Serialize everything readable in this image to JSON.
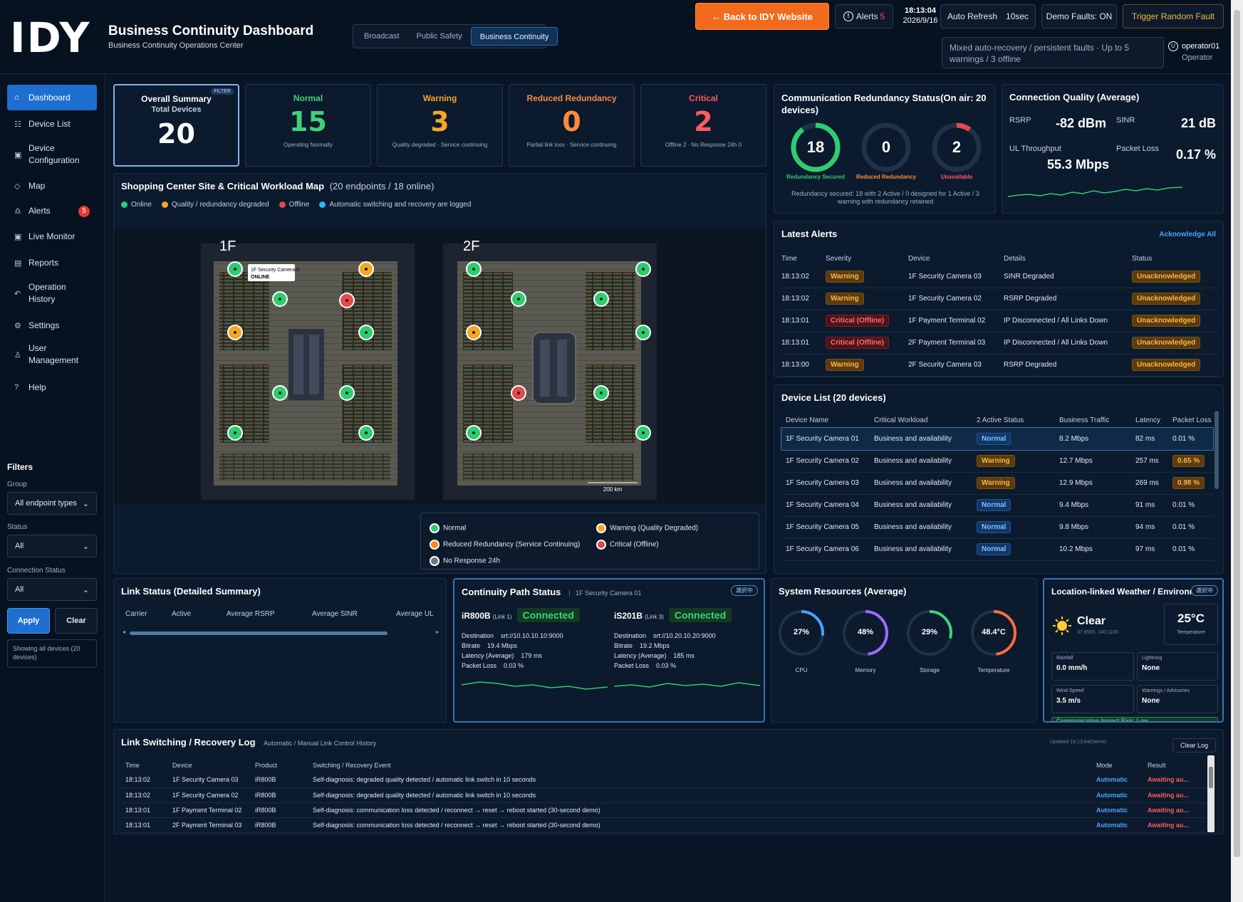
{
  "header": {
    "logo": "IDY",
    "title": "Business Continuity Dashboard",
    "subtitle": "Business Continuity Operations Center",
    "tabs": [
      "Broadcast",
      "Public Safety",
      "Business Continuity"
    ],
    "back_label": "← Back to IDY Website",
    "alerts_label": "Alerts",
    "alerts_count": "5",
    "time": "18:13:04",
    "date": "2026/9/16",
    "auto_refresh_label": "Auto Refresh",
    "auto_refresh_value": "10sec",
    "demo_faults": "Demo Faults: ON",
    "trigger": "Trigger Random Fault",
    "scenario": "Mixed auto-recovery / persistent faults · Up to 5 warnings / 3 offline",
    "operator_name": "operator01",
    "operator_role": "Operator"
  },
  "sidebar": {
    "items": [
      {
        "icon": "⌂",
        "label": "Dashboard"
      },
      {
        "icon": "☷",
        "label": "Device List"
      },
      {
        "icon": "▣",
        "label": "Device Configuration"
      },
      {
        "icon": "◇",
        "label": "Map"
      },
      {
        "icon": "♎",
        "label": "Alerts"
      },
      {
        "icon": "▣",
        "label": "Live Monitor"
      },
      {
        "icon": "▤",
        "label": "Reports"
      },
      {
        "icon": "↶",
        "label": "Operation History"
      },
      {
        "icon": "⚙",
        "label": "Settings"
      },
      {
        "icon": "♙",
        "label": "User Management"
      },
      {
        "icon": "?",
        "label": "Help"
      }
    ],
    "alerts_badge": "5",
    "filters_title": "Filters",
    "group_label": "Group",
    "group_value": "All endpoint types",
    "status_label": "Status",
    "status_value": "All",
    "conn_label": "Connection Status",
    "conn_value": "All",
    "apply": "Apply",
    "clear": "Clear",
    "showing": "Showing all devices (20 devices)"
  },
  "summary": {
    "filter_tag": "FILTER",
    "overall_title": "Overall Summary",
    "overall_sub": "Total Devices",
    "overall_value": "20",
    "normal_title": "Normal",
    "normal_value": "15",
    "normal_sub": "Operating Normally",
    "warning_title": "Warning",
    "warning_value": "3",
    "warning_sub": "Quality degraded · Service continuing",
    "reduced_title": "Reduced Redundancy",
    "reduced_value": "0",
    "reduced_sub": "Partial link loss · Service continuing",
    "critical_title": "Critical",
    "critical_value": "2",
    "critical_sub": "Offline 2 · No Response 24h 0"
  },
  "map": {
    "title": "Shopping Center Site & Critical Workload Map",
    "count": "(20 endpoints / 18 online)",
    "legend_top": [
      "Online",
      "Quality / redundancy degraded",
      "Offline",
      "Automatic switching and recovery are logged"
    ],
    "floor1": "1F",
    "floor2": "2F",
    "tooltip_name": "1F Security Camera 0",
    "tooltip_status": "ONLINE",
    "scale": "200 km",
    "legend": [
      "Normal",
      "Warning (Quality Degraded)",
      "Reduced Redundancy (Service Continuing)",
      "Critical (Offline)",
      "No Response 24h"
    ]
  },
  "redundancy": {
    "title": "Communication Redundancy Status(On air: 20 devices)",
    "secured": "18",
    "secured_label": "Redundancy Secured",
    "reduced": "0",
    "reduced_label": "Reduced Redundancy",
    "unavailable": "2",
    "unavailable_label": "Unavailable",
    "secured_ratio": 0.9,
    "unavailable_ratio": 0.1,
    "note": "Redundancy secured: 18 with 2 Active / 0 designed for 1 Active / 3 warning with redundancy retained"
  },
  "quality": {
    "title": "Connection Quality (Average)",
    "rsrp_label": "RSRP",
    "rsrp_value": "-82 dBm",
    "sinr_label": "SINR",
    "sinr_value": "21 dB",
    "ul_label": "UL Throughput",
    "ul_value": "55.3 Mbps",
    "loss_label": "Packet Loss",
    "loss_value": "0.17 %"
  },
  "alerts": {
    "title": "Latest Alerts",
    "ack_all": "Acknowledge All",
    "columns": [
      "Time",
      "Severity",
      "Device",
      "Details",
      "Status"
    ],
    "rows": [
      {
        "time": "18:13:02",
        "severity": "Warning",
        "device": "1F Security Camera 03",
        "details": "SINR Degraded",
        "status": "Unacknowledged"
      },
      {
        "time": "18:13:02",
        "severity": "Warning",
        "device": "1F Security Camera 02",
        "details": "RSRP Degraded",
        "status": "Unacknowledged"
      },
      {
        "time": "18:13:01",
        "severity": "Critical (Offline)",
        "device": "1F Payment Terminal 02",
        "details": "IP Disconnected / All Links Down",
        "status": "Unacknowledged"
      },
      {
        "time": "18:13:01",
        "severity": "Critical (Offline)",
        "device": "2F Payment Terminal 03",
        "details": "IP Disconnected / All Links Down",
        "status": "Unacknowledged"
      },
      {
        "time": "18:13:00",
        "severity": "Warning",
        "device": "2F Security Camera 03",
        "details": "RSRP Degraded",
        "status": "Unacknowledged"
      }
    ]
  },
  "devices": {
    "title": "Device List (20 devices)",
    "columns": [
      "Device Name",
      "Critical Workload",
      "2 Active Status",
      "Business Traffic",
      "Latency",
      "Packet Loss"
    ],
    "rows": [
      {
        "name": "1F Security Camera 01",
        "workload": "Business and availability",
        "status": "Normal",
        "traffic": "8.2 Mbps",
        "latency": "82 ms",
        "loss": "0.01 %"
      },
      {
        "name": "1F Security Camera 02",
        "workload": "Business and availability",
        "status": "Warning",
        "traffic": "12.7 Mbps",
        "latency": "257 ms",
        "loss": "0.65 %"
      },
      {
        "name": "1F Security Camera 03",
        "workload": "Business and availability",
        "status": "Warning",
        "traffic": "12.9 Mbps",
        "latency": "269 ms",
        "loss": "0.98 %"
      },
      {
        "name": "1F Security Camera 04",
        "workload": "Business and availability",
        "status": "Normal",
        "traffic": "9.4 Mbps",
        "latency": "91 ms",
        "loss": "0.01 %"
      },
      {
        "name": "1F Security Camera 05",
        "workload": "Business and availability",
        "status": "Normal",
        "traffic": "9.8 Mbps",
        "latency": "94 ms",
        "loss": "0.01 %"
      },
      {
        "name": "1F Security Camera 06",
        "workload": "Business and availability",
        "status": "Normal",
        "traffic": "10.2 Mbps",
        "latency": "97 ms",
        "loss": "0.01 %"
      }
    ]
  },
  "link_status": {
    "title": "Link Status (Detailed Summary)",
    "columns": [
      "Carrier",
      "Active",
      "Average RSRP",
      "Average SINR",
      "Average UL"
    ]
  },
  "path": {
    "title": "Continuity Path Status",
    "device": "1F Security Camera 01",
    "tag": "選択中",
    "l1_product": "iR800B",
    "l1_link": "(Link 1)",
    "l1_status": "Connected",
    "l1_dest": "srt://10.10.10.10:9000",
    "l1_bitrate": "19.4 Mbps",
    "l1_latency": "179 ms",
    "l1_loss": "0.03 %",
    "l3_product": "iS201B",
    "l3_link": "(Link 3)",
    "l3_status": "Connected",
    "l3_dest": "srt://10.20.10.20:9000",
    "l3_bitrate": "19.2 Mbps",
    "l3_latency": "185 ms",
    "l3_loss": "0.03 %",
    "dest_label": "Destination",
    "bitrate_label": "Bitrate",
    "latency_label": "Latency (Average)",
    "loss_label": "Packet Loss"
  },
  "resources": {
    "title": "System Resources (Average)",
    "items": [
      {
        "value": "27%",
        "label": "CPU",
        "ratio": 0.27,
        "color": "#4aa3ff"
      },
      {
        "value": "48%",
        "label": "Memory",
        "ratio": 0.48,
        "color": "#9b6bff"
      },
      {
        "value": "29%",
        "label": "Storage",
        "ratio": 0.29,
        "color": "#3fd17a"
      },
      {
        "value": "48.4°C",
        "label": "Temperature",
        "ratio": 0.48,
        "color": "#ff6b3d"
      }
    ]
  },
  "weather": {
    "title": "Location-linked Weather / Environment",
    "tag": "選択中",
    "condition": "Clear",
    "coords": "37.8500, 140.1100",
    "temp": "25°C",
    "temp_label": "Temperature",
    "rain_label": "Rainfall",
    "rain": "0.0 mm/h",
    "lightning_label": "Lightning",
    "lightning": "None",
    "wind_label": "Wind Speed",
    "wind": "3.5 m/s",
    "warnings_label": "Warnings / Advisories",
    "warnings": "None",
    "impact": "Communication Impact Risk: Low",
    "updated": "Updated 18:13:04(Demo)"
  },
  "log": {
    "title": "Link Switching / Recovery Log",
    "subtitle": "Automatic / Manual Link Control History",
    "clear": "Clear Log",
    "columns": [
      "Time",
      "Device",
      "Product",
      "Switching / Recovery Event",
      "Mode",
      "Result"
    ],
    "rows": [
      {
        "time": "18:13:02",
        "device": "1F Security Camera 03",
        "product": "iR800B",
        "event": "Self-diagnosis: degraded quality detected / automatic link switch in 10 seconds",
        "mode": "Automatic",
        "result": "Awaiting au..."
      },
      {
        "time": "18:13:02",
        "device": "1F Security Camera 02",
        "product": "iR800B",
        "event": "Self-diagnosis: degraded quality detected / automatic link switch in 10 seconds",
        "mode": "Automatic",
        "result": "Awaiting au..."
      },
      {
        "time": "18:13:01",
        "device": "1F Payment Terminal 02",
        "product": "iR800B",
        "event": "Self-diagnosis: communication loss detected / reconnect → reset → reboot started (30-second demo)",
        "mode": "Automatic",
        "result": "Awaiting au..."
      },
      {
        "time": "18:13:01",
        "device": "2F Payment Terminal 03",
        "product": "iR800B",
        "event": "Self-diagnosis: communication loss detected / reconnect → reset → reboot started (30-second demo)",
        "mode": "Automatic",
        "result": "Awaiting au..."
      }
    ]
  },
  "colors": {
    "normal": "#2ecc71",
    "warning": "#f5a623",
    "critical": "#e5484d",
    "accent": "#1e6fd0"
  }
}
